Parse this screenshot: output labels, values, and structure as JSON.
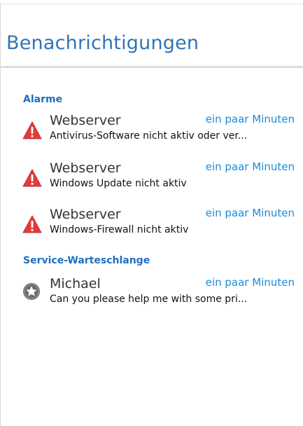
{
  "panel": {
    "title": "Benachrichtigungen"
  },
  "alarms": {
    "section_title": "Alarme",
    "items": [
      {
        "icon": "warning-triangle-icon",
        "sender": "Webserver",
        "time": "ein paar Minuten",
        "message": "Antivirus-Software nicht aktiv oder ver..."
      },
      {
        "icon": "warning-triangle-icon",
        "sender": "Webserver",
        "time": "ein paar Minuten",
        "message": "Windows Update nicht aktiv"
      },
      {
        "icon": "warning-triangle-icon",
        "sender": "Webserver",
        "time": "ein paar Minuten",
        "message": "Windows-Firewall nicht aktiv"
      }
    ]
  },
  "service_queue": {
    "section_title": "Service-Warteschlange",
    "items": [
      {
        "icon": "star-badge-icon",
        "sender": "Michael",
        "time": "ein paar Minuten",
        "message": "Can you please help me with some pri..."
      }
    ]
  },
  "colors": {
    "title": "#2e75b6",
    "section": "#1f6fbf",
    "time": "#1c8ad8",
    "alarm": "#e03c3c",
    "badge": "#6d6d6d"
  }
}
